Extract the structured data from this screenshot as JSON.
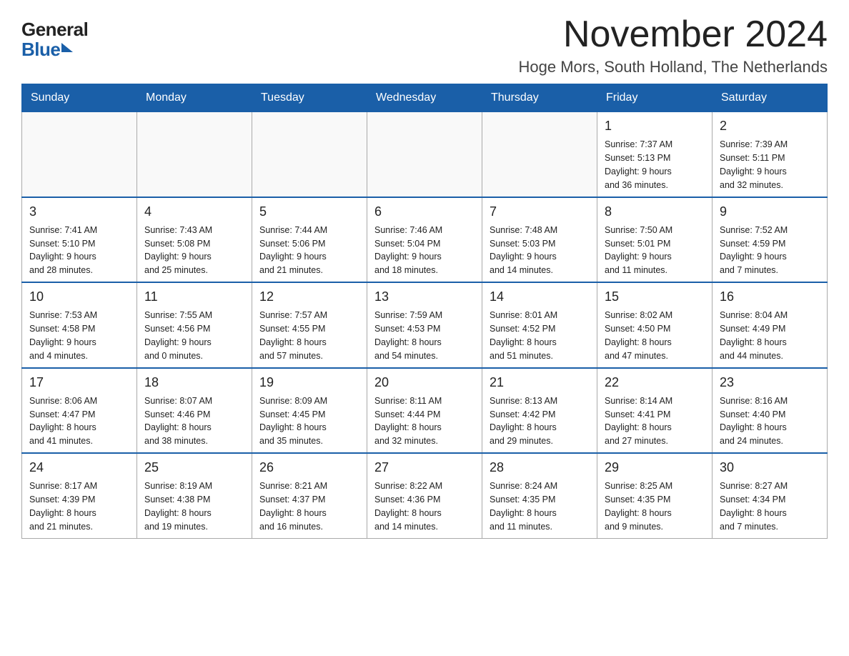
{
  "logo": {
    "general": "General",
    "blue": "Blue"
  },
  "title": "November 2024",
  "subtitle": "Hoge Mors, South Holland, The Netherlands",
  "weekdays": [
    "Sunday",
    "Monday",
    "Tuesday",
    "Wednesday",
    "Thursday",
    "Friday",
    "Saturday"
  ],
  "weeks": [
    [
      {
        "day": "",
        "info": ""
      },
      {
        "day": "",
        "info": ""
      },
      {
        "day": "",
        "info": ""
      },
      {
        "day": "",
        "info": ""
      },
      {
        "day": "",
        "info": ""
      },
      {
        "day": "1",
        "info": "Sunrise: 7:37 AM\nSunset: 5:13 PM\nDaylight: 9 hours\nand 36 minutes."
      },
      {
        "day": "2",
        "info": "Sunrise: 7:39 AM\nSunset: 5:11 PM\nDaylight: 9 hours\nand 32 minutes."
      }
    ],
    [
      {
        "day": "3",
        "info": "Sunrise: 7:41 AM\nSunset: 5:10 PM\nDaylight: 9 hours\nand 28 minutes."
      },
      {
        "day": "4",
        "info": "Sunrise: 7:43 AM\nSunset: 5:08 PM\nDaylight: 9 hours\nand 25 minutes."
      },
      {
        "day": "5",
        "info": "Sunrise: 7:44 AM\nSunset: 5:06 PM\nDaylight: 9 hours\nand 21 minutes."
      },
      {
        "day": "6",
        "info": "Sunrise: 7:46 AM\nSunset: 5:04 PM\nDaylight: 9 hours\nand 18 minutes."
      },
      {
        "day": "7",
        "info": "Sunrise: 7:48 AM\nSunset: 5:03 PM\nDaylight: 9 hours\nand 14 minutes."
      },
      {
        "day": "8",
        "info": "Sunrise: 7:50 AM\nSunset: 5:01 PM\nDaylight: 9 hours\nand 11 minutes."
      },
      {
        "day": "9",
        "info": "Sunrise: 7:52 AM\nSunset: 4:59 PM\nDaylight: 9 hours\nand 7 minutes."
      }
    ],
    [
      {
        "day": "10",
        "info": "Sunrise: 7:53 AM\nSunset: 4:58 PM\nDaylight: 9 hours\nand 4 minutes."
      },
      {
        "day": "11",
        "info": "Sunrise: 7:55 AM\nSunset: 4:56 PM\nDaylight: 9 hours\nand 0 minutes."
      },
      {
        "day": "12",
        "info": "Sunrise: 7:57 AM\nSunset: 4:55 PM\nDaylight: 8 hours\nand 57 minutes."
      },
      {
        "day": "13",
        "info": "Sunrise: 7:59 AM\nSunset: 4:53 PM\nDaylight: 8 hours\nand 54 minutes."
      },
      {
        "day": "14",
        "info": "Sunrise: 8:01 AM\nSunset: 4:52 PM\nDaylight: 8 hours\nand 51 minutes."
      },
      {
        "day": "15",
        "info": "Sunrise: 8:02 AM\nSunset: 4:50 PM\nDaylight: 8 hours\nand 47 minutes."
      },
      {
        "day": "16",
        "info": "Sunrise: 8:04 AM\nSunset: 4:49 PM\nDaylight: 8 hours\nand 44 minutes."
      }
    ],
    [
      {
        "day": "17",
        "info": "Sunrise: 8:06 AM\nSunset: 4:47 PM\nDaylight: 8 hours\nand 41 minutes."
      },
      {
        "day": "18",
        "info": "Sunrise: 8:07 AM\nSunset: 4:46 PM\nDaylight: 8 hours\nand 38 minutes."
      },
      {
        "day": "19",
        "info": "Sunrise: 8:09 AM\nSunset: 4:45 PM\nDaylight: 8 hours\nand 35 minutes."
      },
      {
        "day": "20",
        "info": "Sunrise: 8:11 AM\nSunset: 4:44 PM\nDaylight: 8 hours\nand 32 minutes."
      },
      {
        "day": "21",
        "info": "Sunrise: 8:13 AM\nSunset: 4:42 PM\nDaylight: 8 hours\nand 29 minutes."
      },
      {
        "day": "22",
        "info": "Sunrise: 8:14 AM\nSunset: 4:41 PM\nDaylight: 8 hours\nand 27 minutes."
      },
      {
        "day": "23",
        "info": "Sunrise: 8:16 AM\nSunset: 4:40 PM\nDaylight: 8 hours\nand 24 minutes."
      }
    ],
    [
      {
        "day": "24",
        "info": "Sunrise: 8:17 AM\nSunset: 4:39 PM\nDaylight: 8 hours\nand 21 minutes."
      },
      {
        "day": "25",
        "info": "Sunrise: 8:19 AM\nSunset: 4:38 PM\nDaylight: 8 hours\nand 19 minutes."
      },
      {
        "day": "26",
        "info": "Sunrise: 8:21 AM\nSunset: 4:37 PM\nDaylight: 8 hours\nand 16 minutes."
      },
      {
        "day": "27",
        "info": "Sunrise: 8:22 AM\nSunset: 4:36 PM\nDaylight: 8 hours\nand 14 minutes."
      },
      {
        "day": "28",
        "info": "Sunrise: 8:24 AM\nSunset: 4:35 PM\nDaylight: 8 hours\nand 11 minutes."
      },
      {
        "day": "29",
        "info": "Sunrise: 8:25 AM\nSunset: 4:35 PM\nDaylight: 8 hours\nand 9 minutes."
      },
      {
        "day": "30",
        "info": "Sunrise: 8:27 AM\nSunset: 4:34 PM\nDaylight: 8 hours\nand 7 minutes."
      }
    ]
  ]
}
